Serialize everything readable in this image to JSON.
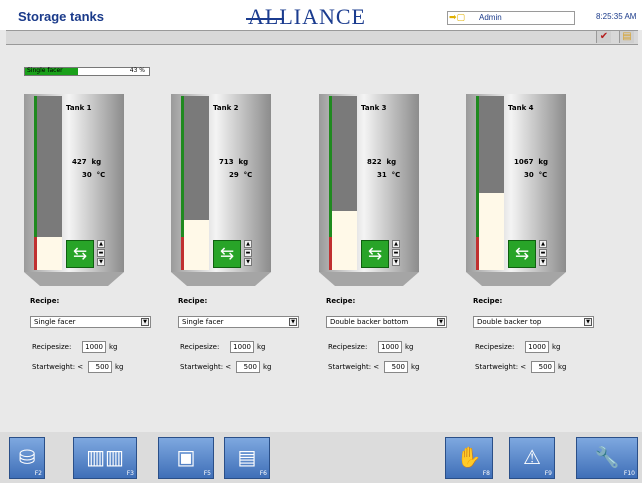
{
  "header": {
    "title": "Storage tanks",
    "logo_text": "ALLIANCE",
    "user": "Admin",
    "time": "8:25:35 AM"
  },
  "progress": {
    "label": "Single facer",
    "percent_text": "43 %",
    "fraction": 0.43
  },
  "tanks": [
    {
      "name": "Tank 1",
      "weight": "427",
      "weight_unit": "kg",
      "temp": "30",
      "temp_unit": "°C",
      "fill": 0.19
    },
    {
      "name": "Tank 2",
      "weight": "713",
      "weight_unit": "kg",
      "temp": "29",
      "temp_unit": "°C",
      "fill": 0.29
    },
    {
      "name": "Tank 3",
      "weight": "822",
      "weight_unit": "kg",
      "temp": "31",
      "temp_unit": "°C",
      "fill": 0.34
    },
    {
      "name": "Tank 4",
      "weight": "1067",
      "weight_unit": "kg",
      "temp": "30",
      "temp_unit": "°C",
      "fill": 0.44
    }
  ],
  "recipes": [
    {
      "title": "Recipe:",
      "selected": "Single facer",
      "size_label": "Recipesize:",
      "size": "1000",
      "size_unit": "kg",
      "start_label": "Startweight: <",
      "start": "500",
      "start_unit": "kg"
    },
    {
      "title": "Recipe:",
      "selected": "Single facer",
      "size_label": "Recipesize:",
      "size": "1000",
      "size_unit": "kg",
      "start_label": "Startweight: <",
      "start": "500",
      "start_unit": "kg"
    },
    {
      "title": "Recipe:",
      "selected": "Double backer bottom",
      "size_label": "Recipesize:",
      "size": "1000",
      "size_unit": "kg",
      "start_label": "Startweight: <",
      "start": "500",
      "start_unit": "kg"
    },
    {
      "title": "Recipe:",
      "selected": "Double backer top",
      "size_label": "Recipesize:",
      "size": "1000",
      "size_unit": "kg",
      "start_label": "Startweight: <",
      "start": "500",
      "start_unit": "kg"
    }
  ],
  "function_keys": [
    {
      "key": "F2",
      "icon": "tank-icon"
    },
    {
      "key": "F3",
      "icon": "multi-tank-icon"
    },
    {
      "key": "F5",
      "icon": "storage-view-icon"
    },
    {
      "key": "F6",
      "icon": "pages-icon"
    },
    {
      "key": "F8",
      "icon": "hand-stop-icon"
    },
    {
      "key": "F9",
      "icon": "warning-icon"
    },
    {
      "key": "F10",
      "icon": "wrench-icon"
    }
  ],
  "colors": {
    "brand": "#1b3c8f",
    "fill_level": "#fff9e8",
    "level_bar_green": "#1f8a1f",
    "level_bar_red": "#c03030",
    "button_green": "#28a428"
  }
}
